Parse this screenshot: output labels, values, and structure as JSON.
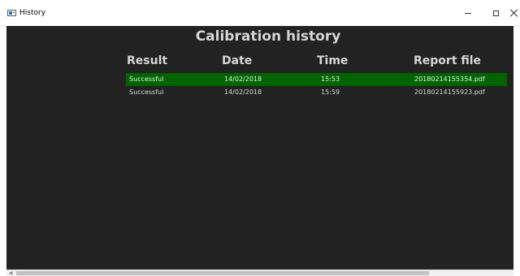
{
  "window": {
    "title": "History",
    "controls": {
      "minimize_icon": "minimize-icon",
      "maximize_icon": "maximize-icon",
      "close_icon": "close-icon"
    }
  },
  "main": {
    "heading": "Calibration history",
    "columns": [
      "Result",
      "Date",
      "Time",
      "Report file"
    ],
    "rows": [
      {
        "result": "Successful",
        "date": "14/02/2018",
        "time": "15:53",
        "report_file": "20180214155354.pdf",
        "selected": true
      },
      {
        "result": "Successful",
        "date": "14/02/2018",
        "time": "15:59",
        "report_file": "20180214155923.pdf",
        "selected": false
      }
    ]
  },
  "colors": {
    "background": "#222222",
    "selected_row": "#006400",
    "header_text": "#d6d6d6"
  }
}
